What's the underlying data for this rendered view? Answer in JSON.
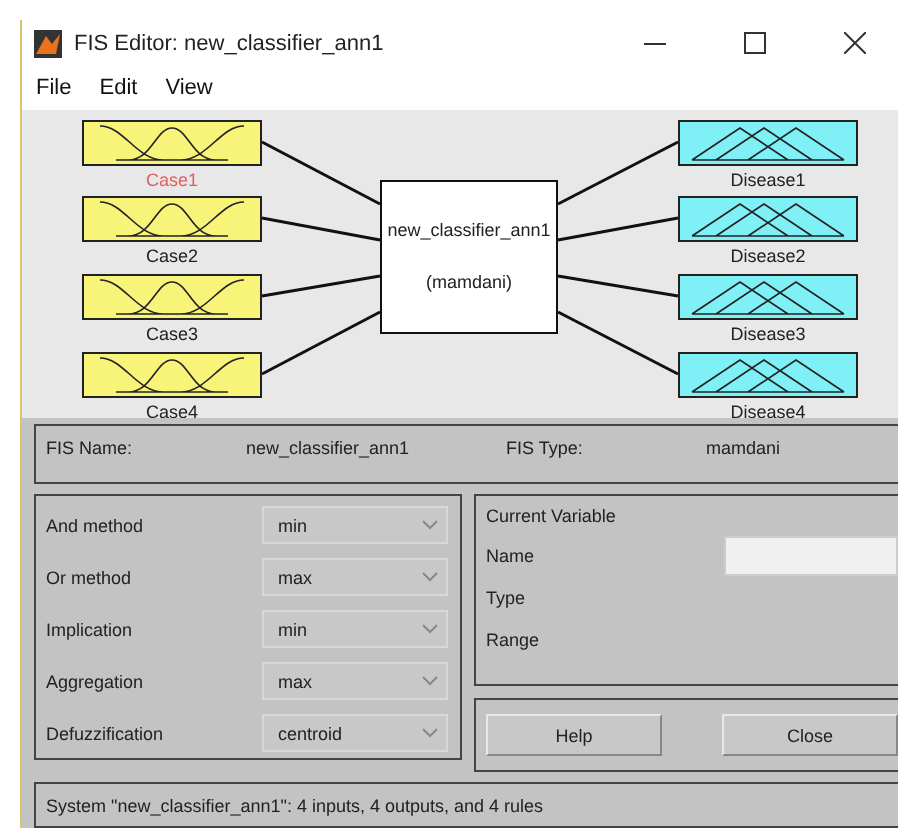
{
  "window": {
    "title": "FIS Editor: new_classifier_ann1"
  },
  "menu": [
    "File",
    "Edit",
    "View"
  ],
  "inputs": [
    {
      "label": "Case1",
      "selected": true
    },
    {
      "label": "Case2",
      "selected": false
    },
    {
      "label": "Case3",
      "selected": false
    },
    {
      "label": "Case4",
      "selected": false
    }
  ],
  "system": {
    "name": "new_classifier_ann1",
    "type": "(mamdani)"
  },
  "outputs": [
    {
      "label": "Disease1",
      "selected": false
    },
    {
      "label": "Disease2",
      "selected": false
    },
    {
      "label": "Disease3",
      "selected": false
    },
    {
      "label": "Disease4",
      "selected": false
    }
  ],
  "fis_info": {
    "name_label": "FIS Name:",
    "name": "new_classifier_ann1",
    "type_label": "FIS Type:",
    "type": "mamdani"
  },
  "methods": [
    {
      "label": "And method",
      "value": "min"
    },
    {
      "label": "Or method",
      "value": "max"
    },
    {
      "label": "Implication",
      "value": "min"
    },
    {
      "label": "Aggregation",
      "value": "max"
    },
    {
      "label": "Defuzzification",
      "value": "centroid"
    }
  ],
  "current_variable": {
    "title": "Current Variable",
    "fields": [
      {
        "label": "Name",
        "kind": "field"
      },
      {
        "label": "Type",
        "kind": "text"
      },
      {
        "label": "Range",
        "kind": "text"
      }
    ]
  },
  "buttons": [
    "Help",
    "Close"
  ],
  "status": "System \"new_classifier_ann1\": 4 inputs, 4 outputs, and 4 rules"
}
